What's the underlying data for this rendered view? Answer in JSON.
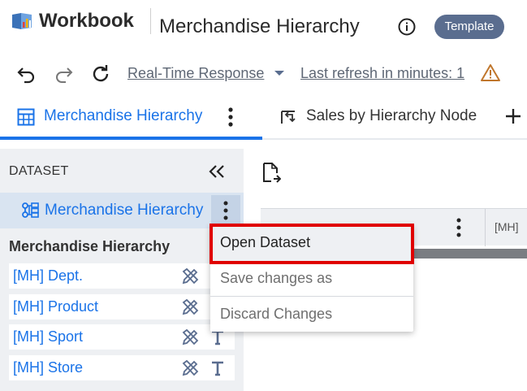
{
  "app": {
    "name": "Workbook"
  },
  "header": {
    "title": "Merchandise Hierarchy",
    "badge": "Template"
  },
  "toolbar": {
    "response_mode": "Real-Time Response",
    "last_refresh": "Last refresh in minutes: 1",
    "warning_color": "#c0762c"
  },
  "tabs": [
    {
      "label": "Merchandise Hierarchy",
      "active": true
    },
    {
      "label": "Sales by Hierarchy Node",
      "active": false
    }
  ],
  "panel": {
    "title": "DATASET",
    "dataset_name": "Merchandise Hierarchy",
    "section_title": "Merchandise Hierarchy",
    "fields": [
      {
        "label": "[MH] Dept.",
        "has_type_icon": false
      },
      {
        "label": "[MH] Product",
        "has_type_icon": false
      },
      {
        "label": "[MH] Sport",
        "has_type_icon": true
      },
      {
        "label": "[MH] Store",
        "has_type_icon": true
      }
    ]
  },
  "grid": {
    "column_label": "[MH]"
  },
  "context_menu": {
    "items": [
      {
        "label": "Open Dataset",
        "state": "highlighted"
      },
      {
        "label": "Save changes as",
        "state": "disabled"
      },
      {
        "label": "Discard Changes",
        "state": "disabled"
      }
    ]
  },
  "colors": {
    "accent": "#1a73e8",
    "badge": "#5a6d8f",
    "highlight_box": "#e00000",
    "panel_bg": "#eef0f3"
  }
}
